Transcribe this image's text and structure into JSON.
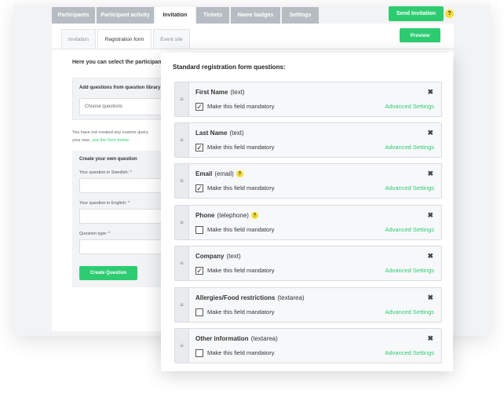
{
  "top_tabs": [
    {
      "label": "Participants",
      "active": false
    },
    {
      "label": "Participant activity",
      "active": false
    },
    {
      "label": "Invitation",
      "active": true
    },
    {
      "label": "Tickets",
      "active": false
    },
    {
      "label": "Name badges",
      "active": false
    },
    {
      "label": "Settings",
      "active": false
    }
  ],
  "send_invitation_label": "Send Invitation",
  "help_glyph": "?",
  "sub_tabs": [
    {
      "label": "Invitation",
      "active": false
    },
    {
      "label": "Registration form",
      "active": true
    },
    {
      "label": "Event site",
      "active": false
    }
  ],
  "preview_label": "Preview",
  "left_panel": {
    "intro": "Here you can select the participant",
    "library_label": "Add questions from question library:",
    "library_placeholder": "Choose questions",
    "no_custom_line1": "You have not created any custom query.",
    "no_custom_line2_prefix": "your own, ",
    "no_custom_link": "use the form below",
    "own_title": "Create your own question",
    "swedish_label": "Your question in Swedish: *",
    "english_label": "Your question in English: *",
    "type_label": "Question type: *",
    "create_label": "Create Question"
  },
  "standard": {
    "title": "Standard registration form questions:",
    "mandatory_label": "Make this field mandatory",
    "advanced_label": "Advanced Settings",
    "questions": [
      {
        "name": "First Name",
        "type": "(text)",
        "help": false,
        "mandatory": true
      },
      {
        "name": "Last Name",
        "type": "(text)",
        "help": false,
        "mandatory": true
      },
      {
        "name": "Email",
        "type": "(email)",
        "help": true,
        "mandatory": true
      },
      {
        "name": "Phone",
        "type": "(telephone)",
        "help": true,
        "mandatory": false
      },
      {
        "name": "Company",
        "type": "(text)",
        "help": false,
        "mandatory": true
      },
      {
        "name": "Allergies/Food restrictions",
        "type": "(textarea)",
        "help": false,
        "mandatory": false
      },
      {
        "name": "Other information",
        "type": "(textarea)",
        "help": false,
        "mandatory": false
      }
    ]
  }
}
